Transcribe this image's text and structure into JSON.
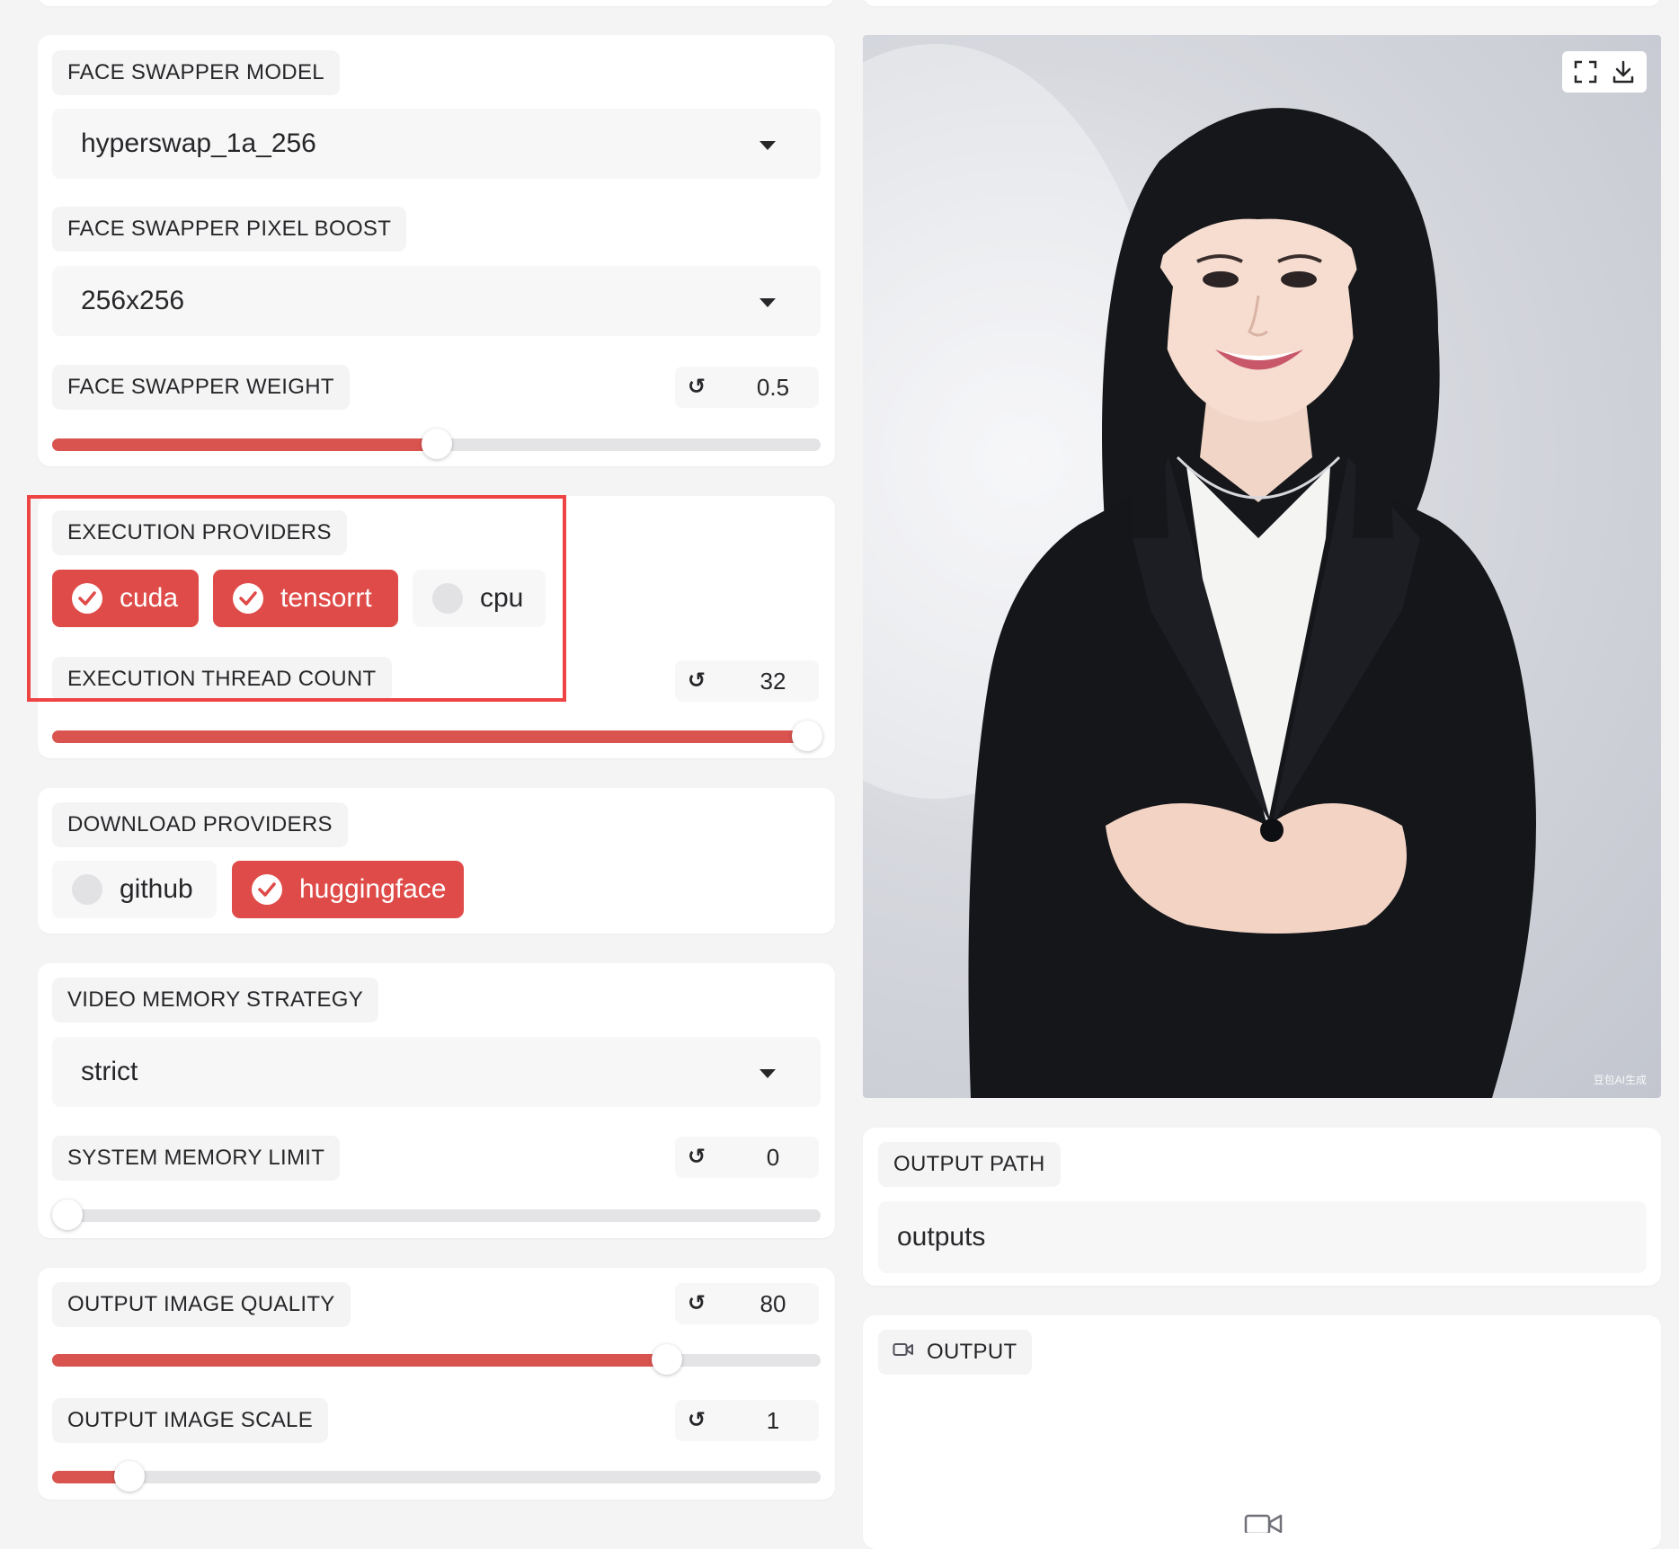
{
  "face_swapper_model": {
    "label": "FACE SWAPPER MODEL",
    "value": "hyperswap_1a_256"
  },
  "face_swapper_pixel_boost": {
    "label": "FACE SWAPPER PIXEL BOOST",
    "value": "256x256"
  },
  "face_swapper_weight": {
    "label": "FACE SWAPPER WEIGHT",
    "reset_icon": "↺",
    "value": "0.5",
    "level": 0.5
  },
  "execution_providers": {
    "label": "EXECUTION PROVIDERS",
    "options": [
      {
        "label": "cuda",
        "checked": true
      },
      {
        "label": "tensorrt",
        "checked": true
      },
      {
        "label": "cpu",
        "checked": false
      }
    ]
  },
  "execution_thread_count": {
    "label": "EXECUTION THREAD COUNT",
    "reset_icon": "↺",
    "value": "32",
    "level": 1.0
  },
  "download_providers": {
    "label": "DOWNLOAD PROVIDERS",
    "options": [
      {
        "label": "github",
        "checked": false
      },
      {
        "label": "huggingface",
        "checked": true
      }
    ]
  },
  "video_memory_strategy": {
    "label": "VIDEO MEMORY STRATEGY",
    "value": "strict"
  },
  "system_memory_limit": {
    "label": "SYSTEM MEMORY LIMIT",
    "reset_icon": "↺",
    "value": "0",
    "level": 0.0
  },
  "output_image_quality": {
    "label": "OUTPUT IMAGE QUALITY",
    "reset_icon": "↺",
    "value": "80",
    "level": 0.8
  },
  "output_image_scale": {
    "label": "OUTPUT IMAGE SCALE",
    "reset_icon": "↺",
    "value": "1",
    "level": 0.1
  },
  "preview": {
    "watermark": "豆包AI生成",
    "fullscreen_icon": "fullscreen-icon",
    "download_icon": "download-icon"
  },
  "output_path": {
    "label": "OUTPUT PATH",
    "value": "outputs"
  },
  "output": {
    "label": "OUTPUT",
    "icon": "video-camera-icon"
  },
  "colors": {
    "accent": "#df4b48",
    "highlight_border": "#ef4444",
    "panel": "#ffffff",
    "background": "#f4f4f5"
  }
}
